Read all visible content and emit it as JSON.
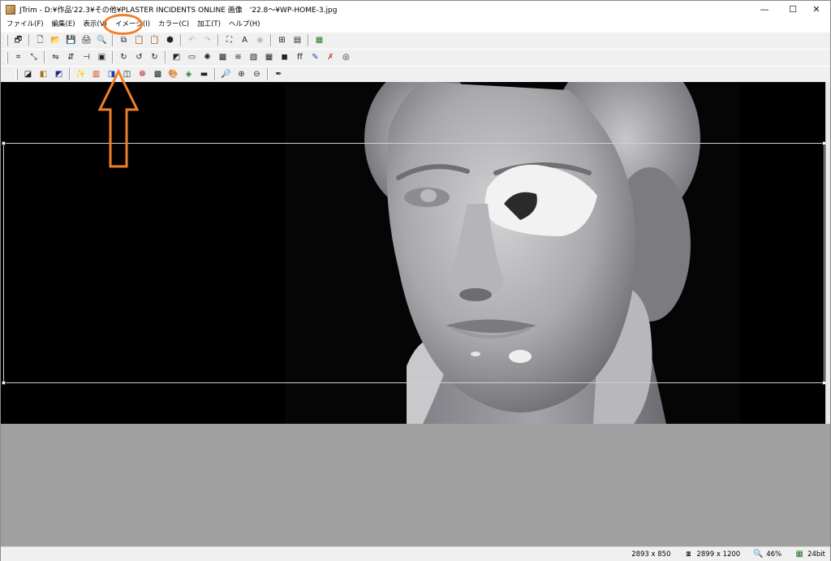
{
  "window": {
    "title": "JTrim - D:¥作品'22.3¥その他¥PLASTER INCIDENTS ONLINE 画像　'22.8～¥WP-HOME-3.jpg",
    "minimize_glyph": "—",
    "maximize_glyph": "☐",
    "close_glyph": "✕"
  },
  "menu": [
    {
      "label": "ファイル(F)"
    },
    {
      "label": "編集(E)"
    },
    {
      "label": "表示(V)"
    },
    {
      "label": "イメージ(I)"
    },
    {
      "label": "カラー(C)"
    },
    {
      "label": "加工(T)"
    },
    {
      "label": "ヘルプ(H)"
    }
  ],
  "toolbar1": [
    {
      "icon": "window-icon",
      "glyph": "🗗"
    },
    {
      "icon": "new-file-icon",
      "glyph": "🗋"
    },
    {
      "icon": "open-folder-icon",
      "glyph": "📂"
    },
    {
      "icon": "save-icon",
      "glyph": "💾"
    },
    {
      "icon": "print-icon",
      "glyph": "🖨"
    },
    {
      "icon": "print-preview-icon",
      "glyph": "🔍"
    },
    {
      "icon": "copy-icon",
      "glyph": "⧉"
    },
    {
      "icon": "paste-icon",
      "glyph": "📋"
    },
    {
      "icon": "paste-new-icon",
      "glyph": "📋"
    },
    {
      "icon": "capture-icon",
      "glyph": "⬢"
    },
    {
      "icon": "undo-icon",
      "glyph": "↶"
    },
    {
      "icon": "redo-icon",
      "glyph": "↷"
    },
    {
      "icon": "fit-window-icon",
      "glyph": "⛶"
    },
    {
      "icon": "text-icon",
      "glyph": "A"
    },
    {
      "icon": "sphere-icon",
      "glyph": "◉"
    },
    {
      "icon": "thumbnail-grid-icon",
      "glyph": "⊞"
    },
    {
      "icon": "film-strip-icon",
      "glyph": "▤"
    },
    {
      "icon": "batch-icon",
      "glyph": "▦"
    }
  ],
  "toolbar2": [
    {
      "icon": "crop-icon",
      "glyph": "⌗"
    },
    {
      "icon": "resize-icon",
      "glyph": "⤡"
    },
    {
      "icon": "flip-horizontal-icon",
      "glyph": "⇋"
    },
    {
      "icon": "flip-vertical-icon",
      "glyph": "⇵"
    },
    {
      "icon": "split-icon",
      "glyph": "⊣"
    },
    {
      "icon": "frame-icon",
      "glyph": "▣"
    },
    {
      "icon": "rotate-free-icon",
      "glyph": "↻"
    },
    {
      "icon": "rotate-left-icon",
      "glyph": "↺"
    },
    {
      "icon": "rotate-right-icon",
      "glyph": "↻"
    },
    {
      "icon": "shadow-icon",
      "glyph": "◩"
    },
    {
      "icon": "border-icon",
      "glyph": "▭"
    },
    {
      "icon": "sun-icon",
      "glyph": "✺"
    },
    {
      "icon": "mosaic-icon",
      "glyph": "▩"
    },
    {
      "icon": "wave-icon",
      "glyph": "≋"
    },
    {
      "icon": "emboss-icon",
      "glyph": "▧"
    },
    {
      "icon": "tile-icon",
      "glyph": "▦"
    },
    {
      "icon": "blur-icon",
      "glyph": "◼"
    },
    {
      "icon": "sharpen-icon",
      "glyph": "ff"
    },
    {
      "icon": "pen-icon",
      "glyph": "✎"
    },
    {
      "icon": "clear-icon",
      "glyph": "✗"
    },
    {
      "icon": "spiral-icon",
      "glyph": "◎"
    }
  ],
  "toolbar3": [
    {
      "icon": "gradient-icon",
      "glyph": "◪"
    },
    {
      "icon": "tone-icon",
      "glyph": "◧"
    },
    {
      "icon": "color-balance-icon",
      "glyph": "◩"
    },
    {
      "icon": "sparkle-icon",
      "glyph": "✨"
    },
    {
      "icon": "rainbow-icon",
      "glyph": "▥"
    },
    {
      "icon": "contrast-icon",
      "glyph": "◨"
    },
    {
      "icon": "posterize-icon",
      "glyph": "◫"
    },
    {
      "icon": "color-wheel-icon",
      "glyph": "❁"
    },
    {
      "icon": "dither-icon",
      "glyph": "▩"
    },
    {
      "icon": "palette-icon",
      "glyph": "🎨"
    },
    {
      "icon": "hdr-icon",
      "glyph": "◈"
    },
    {
      "icon": "grayscale-icon",
      "glyph": "▬"
    },
    {
      "icon": "zoom-menu-icon",
      "glyph": "🔎"
    },
    {
      "icon": "zoom-in-icon",
      "glyph": "⊕"
    },
    {
      "icon": "zoom-out-icon",
      "glyph": "⊖"
    },
    {
      "icon": "eyedropper-icon",
      "glyph": "✒"
    }
  ],
  "status": {
    "selection_size": "2893 x 850",
    "image_size": "2899 x 1200",
    "zoom": "46%",
    "bit_depth": "24bit",
    "image_size_icon": "⧆",
    "zoom_icon": "🔍",
    "bit_depth_icon": "▦"
  },
  "colors": {
    "annotation": "#f07f2a",
    "image_background": "#000000",
    "viewport_background": "#a0a0a0"
  }
}
